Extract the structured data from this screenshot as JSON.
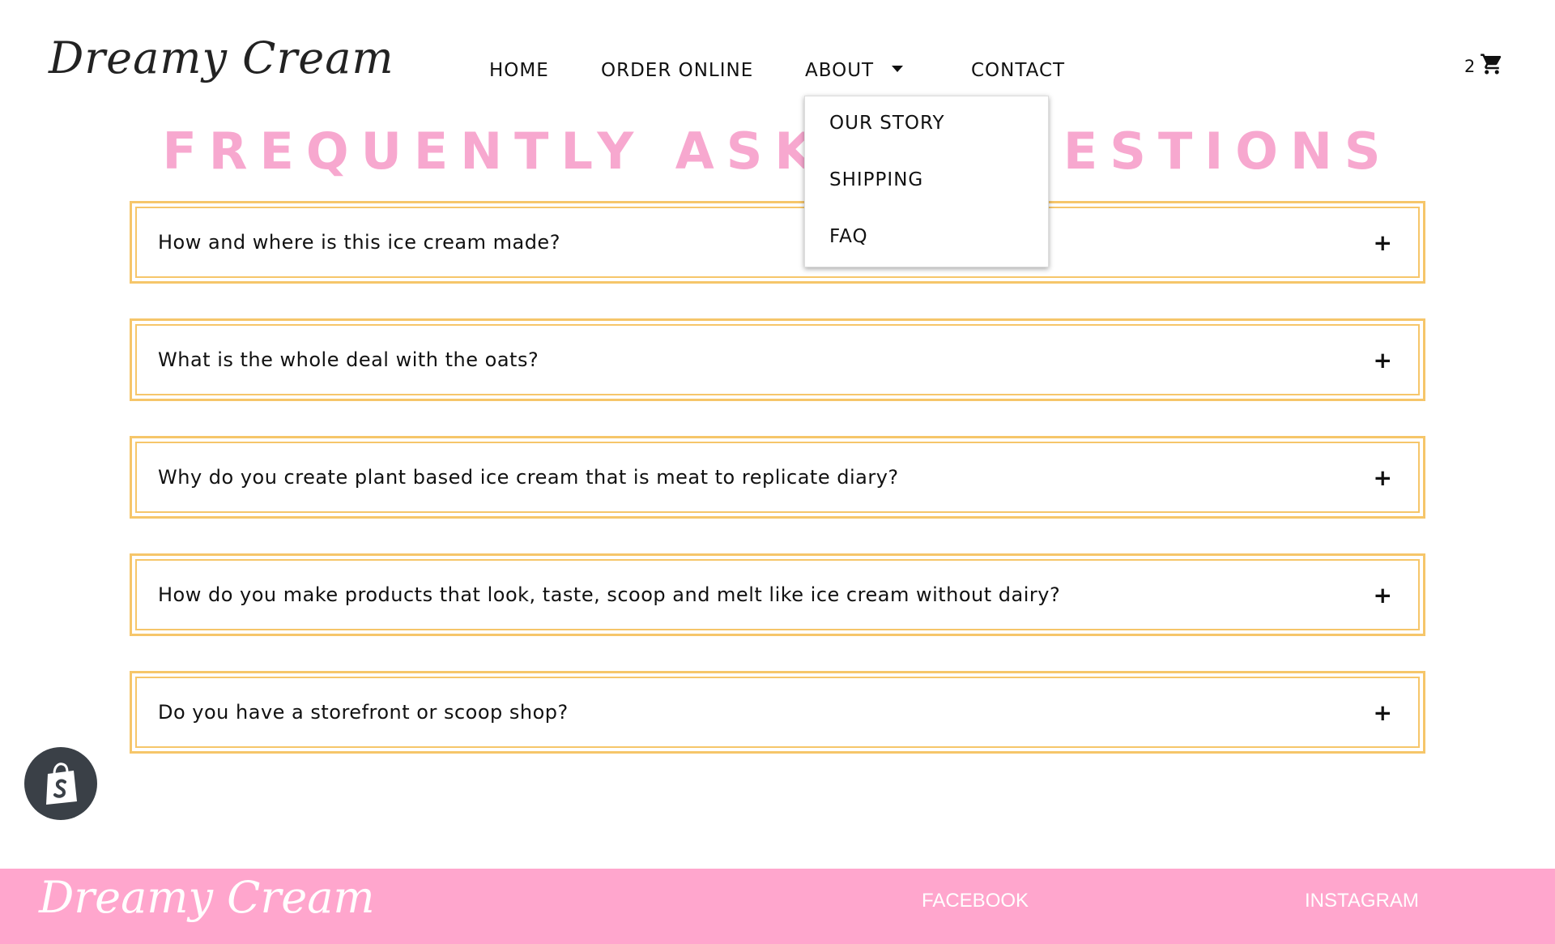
{
  "brand": {
    "logo_text": "Dreamy Cream"
  },
  "nav": {
    "home": "HOME",
    "order_online": "ORDER ONLINE",
    "about": "ABOUT",
    "contact": "CONTACT"
  },
  "cart": {
    "count": "2",
    "icon": "cart-icon"
  },
  "about_dropdown": {
    "items": [
      {
        "label": "OUR STORY"
      },
      {
        "label": "SHIPPING"
      },
      {
        "label": "FAQ"
      }
    ]
  },
  "faq": {
    "title": "FREQUENTLY ASKED QUESTIONS",
    "expand_symbol": "+",
    "questions": [
      {
        "text": "How and where is this ice cream made?"
      },
      {
        "text": "What is the whole deal with the oats?"
      },
      {
        "text": "Why do you create plant based ice cream that is meat to replicate diary?"
      },
      {
        "text": "How do you make products that look, taste, scoop and melt like ice cream without dairy?"
      },
      {
        "text": "Do you have a storefront or scoop shop?"
      }
    ]
  },
  "footer": {
    "logo_text": "Dreamy Cream",
    "facebook": "FACEBOOK",
    "instagram": "INSTAGRAM"
  },
  "colors": {
    "title_pink": "#f7a8cf",
    "border_gold": "#f6c66a",
    "footer_pink": "#ffa6cd",
    "badge_dark": "#3a4047"
  }
}
